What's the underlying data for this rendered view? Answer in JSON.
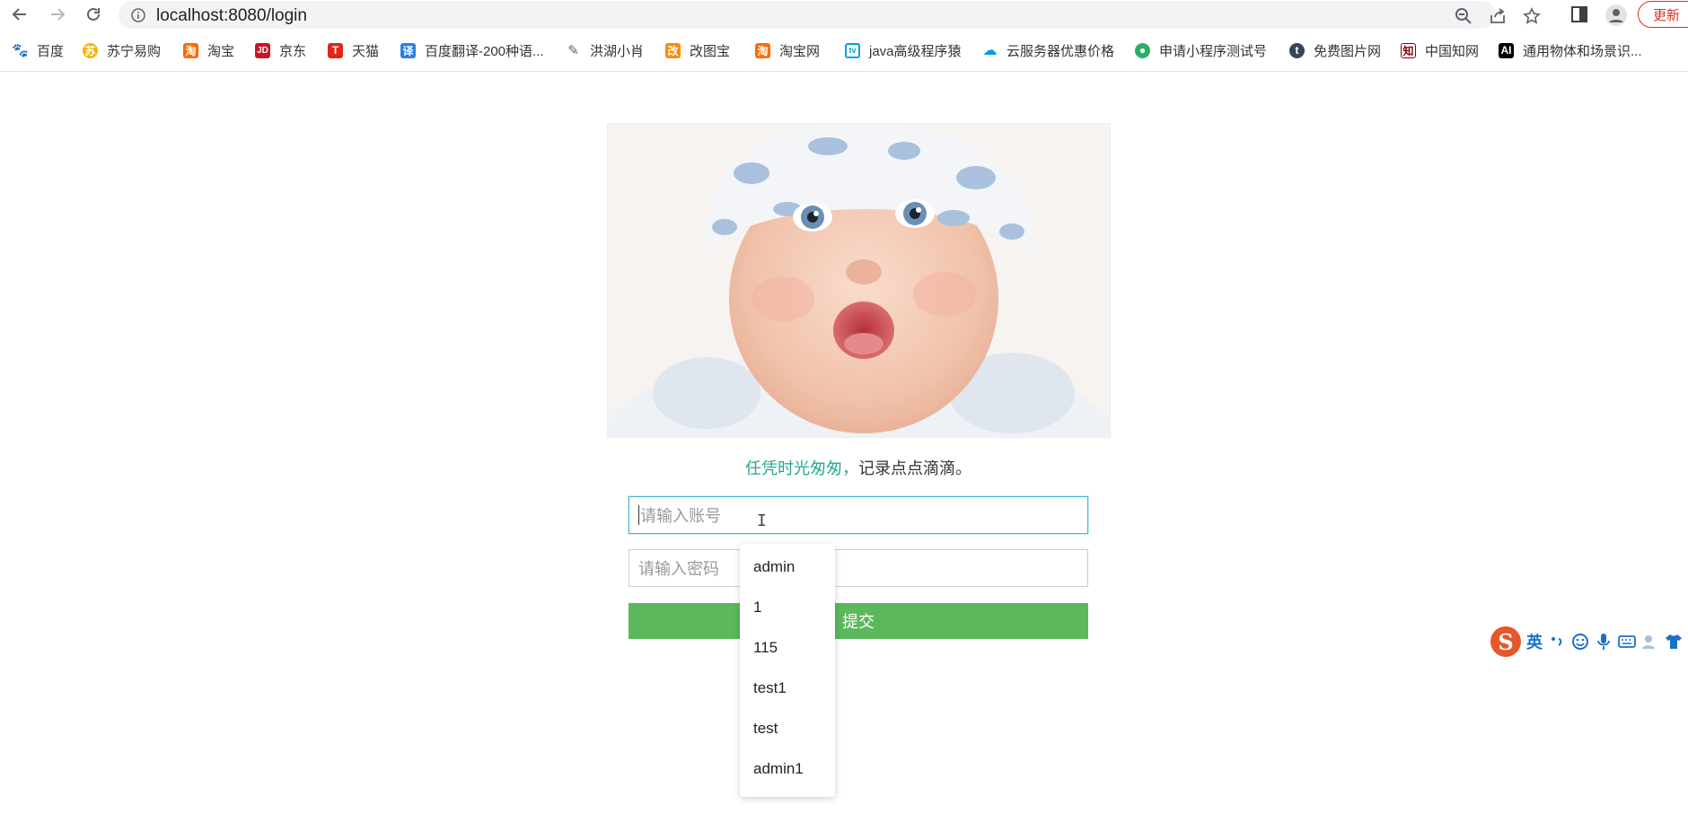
{
  "browser": {
    "url": "localhost:8080/login",
    "update_label": "更新",
    "icons": {
      "back": "back-arrow-icon",
      "forward": "forward-arrow-icon",
      "reload": "reload-icon",
      "site_info": "info-icon",
      "zoom": "zoom-icon",
      "share": "share-icon",
      "bookmark": "star-icon",
      "side_panel": "side-panel-icon",
      "profile": "profile-icon"
    }
  },
  "bookmarks": [
    {
      "label": "百度",
      "icon": "baidu-icon",
      "color": "#2932e1"
    },
    {
      "label": "苏宁易购",
      "icon": "suning-icon",
      "color": "#f7b500"
    },
    {
      "label": "淘宝",
      "icon": "taobao-icon",
      "color": "#ff6a00"
    },
    {
      "label": "京东",
      "icon": "jd-icon",
      "color": "#c81623"
    },
    {
      "label": "天猫",
      "icon": "tmall-icon",
      "color": "#e1251b"
    },
    {
      "label": "百度翻译-200种语...",
      "icon": "translate-icon",
      "color": "#2a7fe0"
    },
    {
      "label": "洪湖小肖",
      "icon": "bird-icon",
      "color": "#666666"
    },
    {
      "label": "改图宝",
      "icon": "gaitubao-icon",
      "color": "#ff8a00"
    },
    {
      "label": "淘宝网",
      "icon": "taobao-icon",
      "color": "#ff6a00"
    },
    {
      "label": "java高级程序猿",
      "icon": "bilibili-icon",
      "color": "#00a1d6"
    },
    {
      "label": "云服务器优惠价格",
      "icon": "cloud-icon",
      "color": "#00a1d6"
    },
    {
      "label": "申请小程序测试号",
      "icon": "wechat-icon",
      "color": "#2aae67"
    },
    {
      "label": "免费图片网",
      "icon": "tumblr-icon",
      "color": "#35465c"
    },
    {
      "label": "中国知网",
      "icon": "cnki-icon",
      "color": "#8b0000"
    },
    {
      "label": "通用物体和场景识...",
      "icon": "ai-icon",
      "color": "#000000"
    }
  ],
  "login": {
    "hero_image": "baby-photo",
    "slogan_accent": "任凭时光匆匆，",
    "slogan_rest": "记录点点滴滴。",
    "account_placeholder": "请输入账号",
    "password_placeholder": "请输入密码",
    "submit_label": "提交"
  },
  "autocomplete": [
    "admin",
    "1",
    "115",
    "test1",
    "test",
    "admin1"
  ],
  "ime": {
    "logo": "S",
    "mode": "英",
    "icons": [
      "punctuation-icon",
      "emoji-icon",
      "mic-icon",
      "keyboard-icon",
      "user-icon",
      "shirt-icon"
    ]
  }
}
